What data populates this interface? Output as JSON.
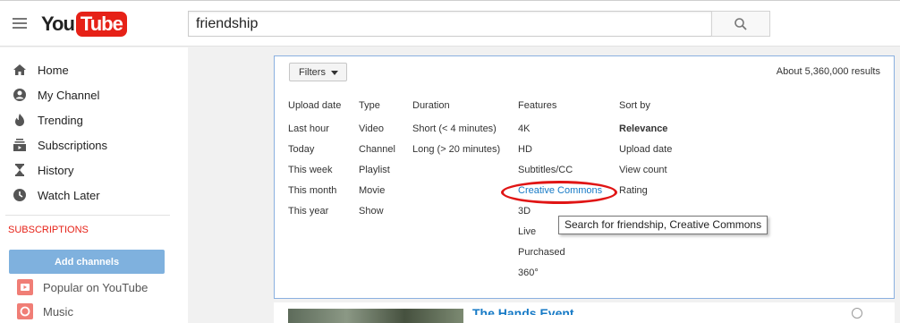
{
  "header": {
    "logo_you": "You",
    "logo_tube": "Tube",
    "search_value": "friendship"
  },
  "sidebar": {
    "items": [
      {
        "label": "Home",
        "icon": "home-icon"
      },
      {
        "label": "My Channel",
        "icon": "person-icon"
      },
      {
        "label": "Trending",
        "icon": "flame-icon"
      },
      {
        "label": "Subscriptions",
        "icon": "subscriptions-icon"
      },
      {
        "label": "History",
        "icon": "hourglass-icon"
      },
      {
        "label": "Watch Later",
        "icon": "clock-icon"
      }
    ],
    "subscriptions_heading": "SUBSCRIPTIONS",
    "add_channels_label": "Add channels",
    "subscriptions": [
      {
        "label": "Popular on YouTube"
      },
      {
        "label": "Music"
      }
    ]
  },
  "filters": {
    "button_label": "Filters",
    "results_count": "About 5,360,000 results",
    "columns": [
      {
        "heading": "Upload date",
        "options": [
          "Last hour",
          "Today",
          "This week",
          "This month",
          "This year"
        ]
      },
      {
        "heading": "Type",
        "options": [
          "Video",
          "Channel",
          "Playlist",
          "Movie",
          "Show"
        ]
      },
      {
        "heading": "Duration",
        "options": [
          "Short (< 4 minutes)",
          "Long (> 20 minutes)"
        ]
      },
      {
        "heading": "Features",
        "options": [
          "4K",
          "HD",
          "Subtitles/CC",
          "Creative Commons",
          "3D",
          "Live",
          "Purchased",
          "360°"
        ]
      },
      {
        "heading": "Sort by",
        "options": [
          "Relevance",
          "Upload date",
          "View count",
          "Rating"
        ]
      }
    ],
    "tooltip": "Search for friendship, Creative Commons"
  },
  "result": {
    "title": "The Hands Event"
  },
  "colors": {
    "brand_red": "#e62117",
    "link_blue": "#167ac6",
    "add_channels_bg": "#7fb1de",
    "annotation_red": "#e01515"
  }
}
